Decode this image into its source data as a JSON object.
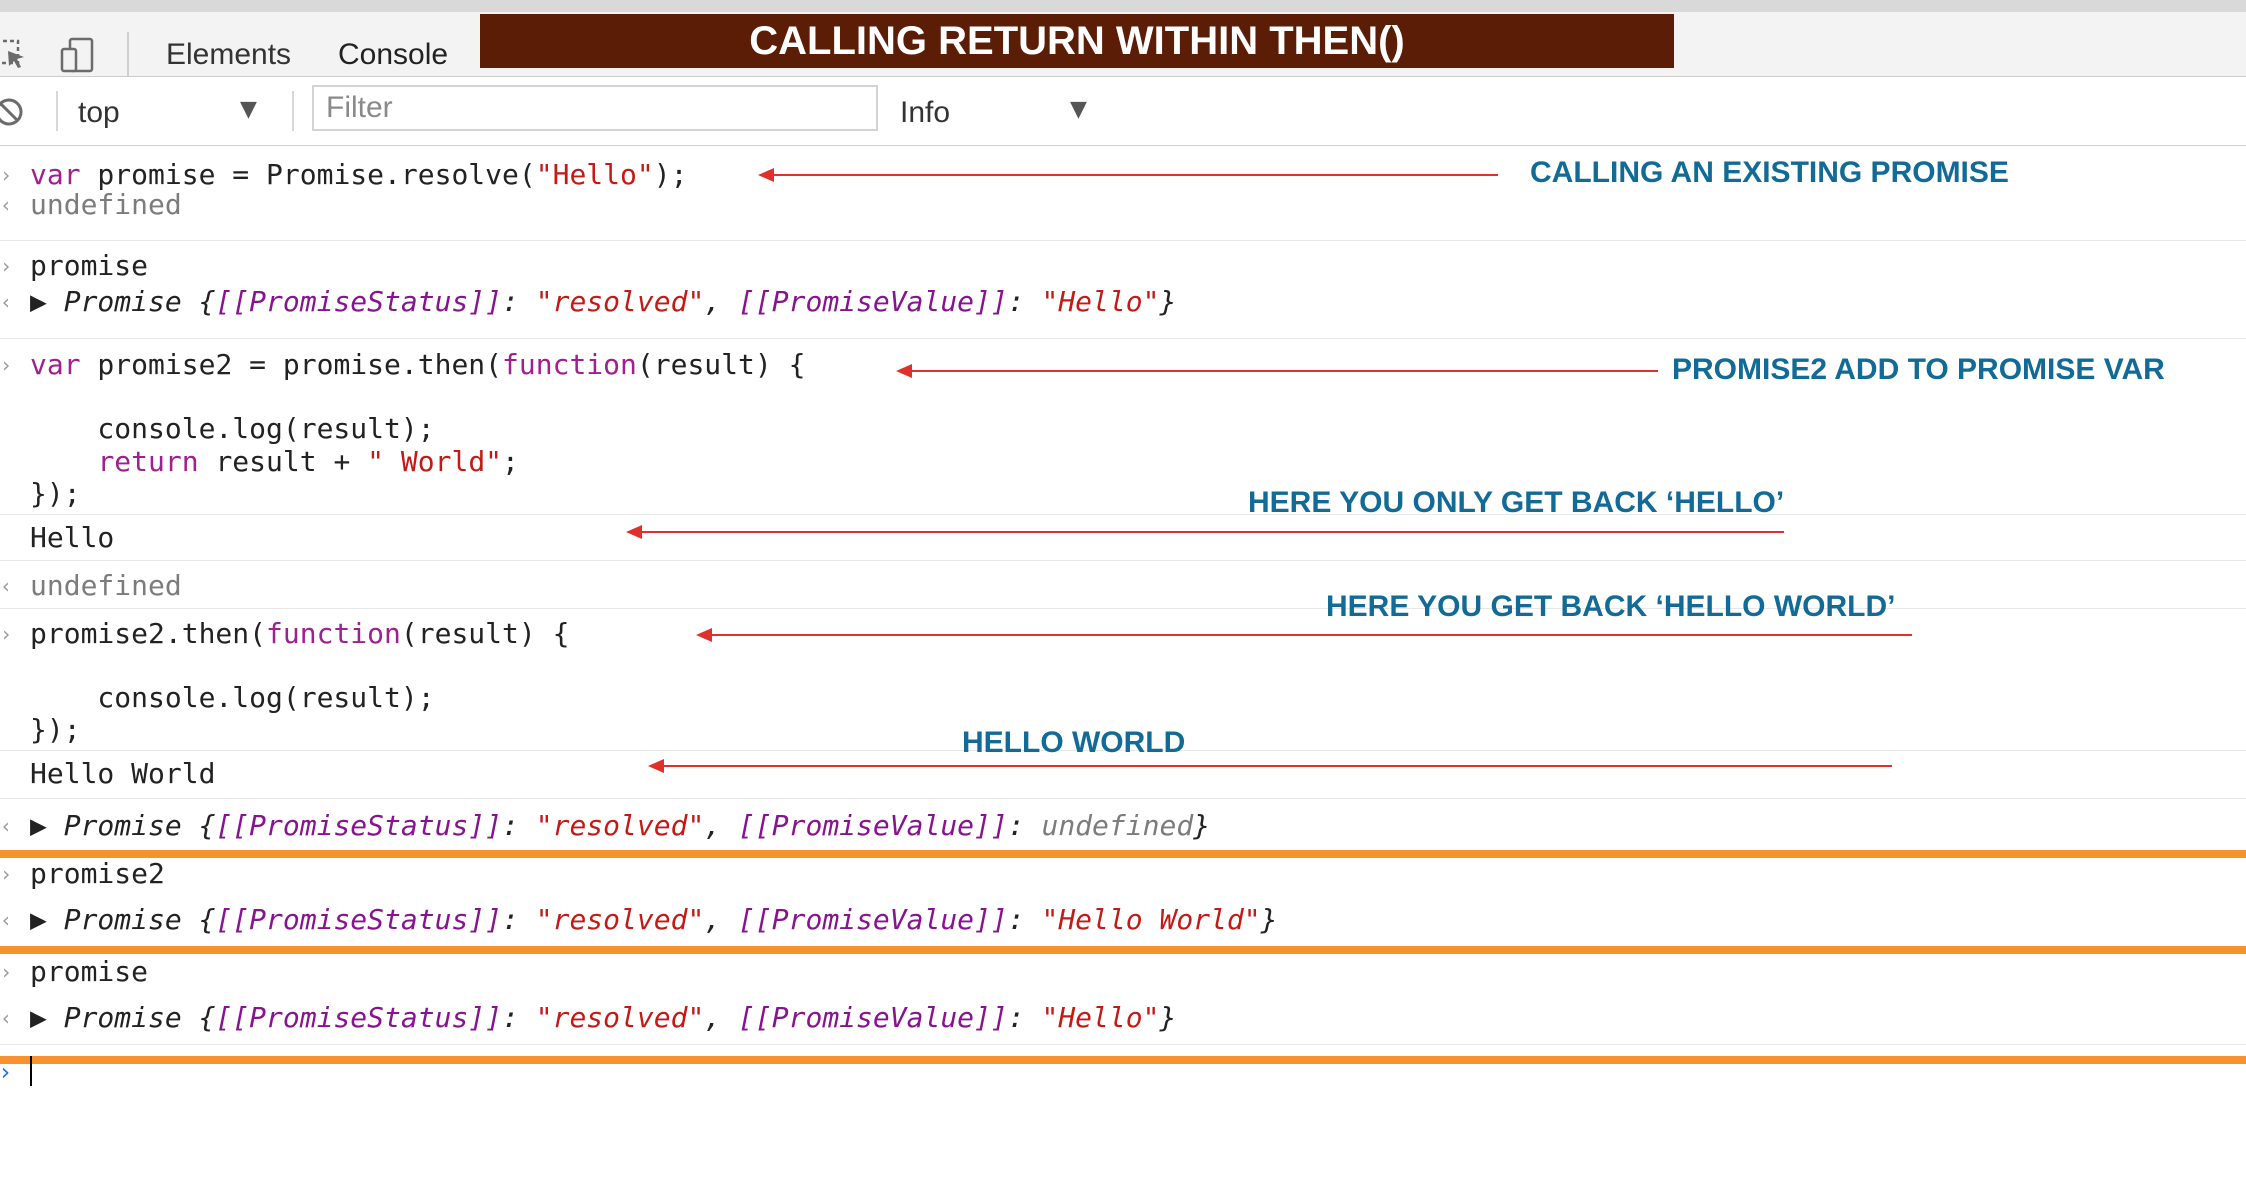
{
  "toolbar": {
    "tab_elements": "Elements",
    "tab_console": "Console",
    "banner": "CALLING RETURN WITHIN THEN()",
    "inspect_icon": "inspect-cursor-icon",
    "device_icon": "device-toggle-icon"
  },
  "filterbar": {
    "context": "top",
    "filter_placeholder": "Filter",
    "level": "Info",
    "clear_icon": "clear-console-icon"
  },
  "console": {
    "l1": "var promise = Promise.resolve(\"Hello\");",
    "l2": "undefined",
    "l3": "promise",
    "l4": "Promise {[[PromiseStatus]]: \"resolved\", [[PromiseValue]]: \"Hello\"}",
    "l5": "var promise2 = promise.then(function(result) {",
    "l6": "",
    "l7": "    console.log(result);",
    "l8": "    return result + \" World\";",
    "l9": "});",
    "l10": "Hello",
    "l11": "undefined",
    "l12": "promise2.then(function(result) {",
    "l13": "",
    "l14": "    console.log(result);",
    "l15": "});",
    "l16": "Hello World",
    "l17": "Promise {[[PromiseStatus]]: \"resolved\", [[PromiseValue]]: undefined}",
    "l18": "promise2",
    "l19": "Promise {[[PromiseStatus]]: \"resolved\", [[PromiseValue]]: \"Hello World\"}",
    "l20": "promise",
    "l21": "Promise {[[PromiseStatus]]: \"resolved\", [[PromiseValue]]: \"Hello\"}"
  },
  "annotations": {
    "a1": "CALLING AN EXISTING PROMISE",
    "a2": "PROMISE2 ADD TO PROMISE VAR",
    "a3": "HERE YOU ONLY GET BACK ‘HELLO’",
    "a4": "HERE YOU GET BACK ‘HELLO WORLD’",
    "a5": "HELLO WORLD"
  },
  "colors": {
    "banner": "#5c1d06",
    "annotation_text": "#126b96",
    "arrow": "#e1302b",
    "highlight_rule": "#f7922f",
    "keyword": "#a0208e",
    "string": "#c41a16"
  }
}
